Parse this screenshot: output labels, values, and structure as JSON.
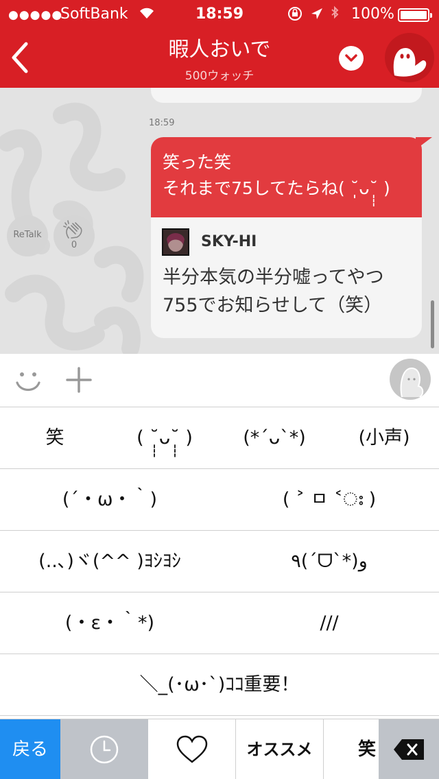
{
  "status_bar": {
    "signal": "●●●●●",
    "carrier": "SoftBank",
    "time": "18:59",
    "battery": "100%"
  },
  "header": {
    "title": "暇人おいで",
    "subtitle": "500ウォッチ"
  },
  "chat": {
    "timestamp": "18:59",
    "message_lines": [
      "笑った笑",
      "それまで75してたらね( ˘̩̩̩ᴗ˘̩̩̩ )"
    ],
    "quote": {
      "name": "SKY-HI",
      "text_lines": [
        "半分本気の半分嘘ってやつ",
        "755でお知らせして（笑）"
      ]
    },
    "retalk_label": "ReTalk",
    "clap_count": "0"
  },
  "keyboard": {
    "rows": [
      [
        "笑",
        "( ˘̩̩̩ᴗ˘̩̩̩ )",
        "(*´ᴗ`*)",
        "(小声)"
      ],
      [
        "(´・ω・｀)",
        "( ˃ ㅁ ˂ഃ )"
      ],
      [
        "(..､)ヾ(^^ )ﾖｼﾖｼ",
        "٩(ˊᗜˋ*)و"
      ],
      [
        "(・ε・｀*)",
        "///"
      ],
      [
        "＼_(･ω･`)ｺｺ重要！"
      ]
    ]
  },
  "tabs": {
    "back": "戻る",
    "recommend": "オススメ",
    "warai": "笑"
  },
  "colors": {
    "brand_red": "#d81f25",
    "bubble_red": "#e23b3f",
    "tab_blue": "#1f8ef1",
    "tab_gray": "#bfc3c9"
  }
}
